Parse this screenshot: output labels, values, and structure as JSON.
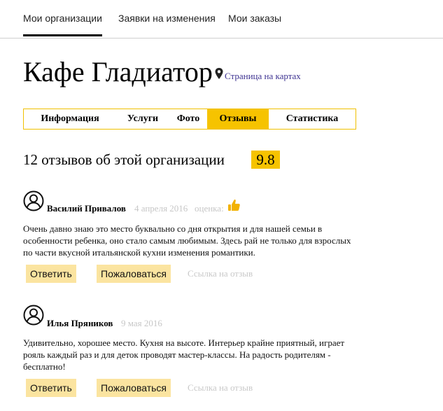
{
  "top_nav": {
    "items": [
      {
        "label": "Мои организации",
        "active": true
      },
      {
        "label": "Заявки на изменения",
        "active": false
      },
      {
        "label": "Мои заказы",
        "active": false
      }
    ]
  },
  "org": {
    "title": "Кафе Гладиатор",
    "map_link": "Страница на картах",
    "map_icon": "map-pin-icon"
  },
  "tabs": [
    {
      "label": "Информация",
      "active": false
    },
    {
      "label": "Услуги",
      "active": false
    },
    {
      "label": "Фото",
      "active": false
    },
    {
      "label": "Отзывы",
      "active": true
    },
    {
      "label": "Статистика",
      "active": false
    }
  ],
  "reviews_summary": {
    "title": "12 отзывов об этой организации",
    "rating": "9.8"
  },
  "reviews": [
    {
      "avatar_icon": "user-avatar-icon",
      "author": "Василий Привалов",
      "date": "4 апреля 2016",
      "score_label": "оценка:",
      "score_icon": "thumbs-up-icon",
      "text": "Очень давно знаю это место буквально со дня открытия и для нашей семьи в особенности ребенка, оно стало самым любимым. Здесь рай не только для взрослых по части вкусной итальянской кухни изменения романтики.",
      "reply": "Ответить",
      "complain": "Пожаловаться",
      "link": "Ссылка на отзыв"
    },
    {
      "avatar_icon": "user-avatar-icon",
      "author": "Илья Пряников",
      "date": "9 мая 2016",
      "text": "Удивительно, хорошее место. Кухня на высоте. Интерьер крайне приятный, играет рояль каждый раз и для деток проводят мастер-классы. На радость родителям - бесплатно!",
      "reply": "Ответить",
      "complain": "Пожаловаться",
      "link": "Ссылка на отзыв"
    }
  ],
  "colors": {
    "accent": "#f6c300",
    "button_bg": "#fbe4a0",
    "link": "#3d3291",
    "muted": "#c7c7c7"
  }
}
